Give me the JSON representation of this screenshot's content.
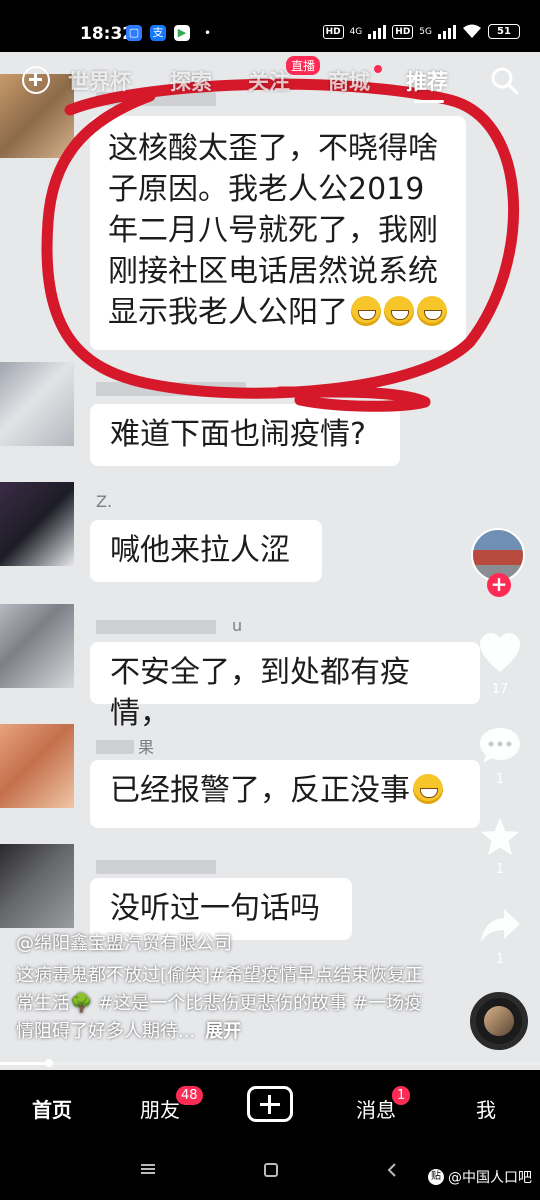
{
  "status_bar": {
    "time": "18:32",
    "app_icons": [
      "message-app-icon",
      "alipay-icon",
      "play-store-icon"
    ],
    "network_left": "4G",
    "network_right": "5G",
    "hd_label": "HD",
    "battery": "51"
  },
  "top_tabs": {
    "items": [
      "世界杯",
      "探索",
      "关注",
      "商城",
      "推荐"
    ],
    "active": "推荐",
    "live_badge": "直播"
  },
  "chat": {
    "messages": [
      {
        "text": "这核酸太歪了，不晓得啥子原因。我老人公2019年二月八号就死了，我刚刚接社区电话居然说系统显示我老人公阳了",
        "emoji_count": 3
      },
      {
        "text": "难道下面也闹疫情?"
      },
      {
        "name": "Z.",
        "text": "喊他来拉人涩"
      },
      {
        "name": "u",
        "text": "不安全了，到处都有疫情，"
      },
      {
        "name": "果",
        "text": "已经报警了，反正没事",
        "emoji_count": 1
      },
      {
        "text": "没听过一句话吗"
      }
    ]
  },
  "rail": {
    "like_count": "17",
    "comment_count": "1",
    "favorite_count": "1",
    "share_count": "1",
    "follow_symbol": "+"
  },
  "caption": {
    "author": "@绵阳鑫宝盟汽贸有限公司",
    "text": "这病毒鬼都不放过[偷笑]#希望疫情早点结束恢复正常生活🌳 #这是一个比悲伤更悲伤的故事 #一场疫情阻碍了好多人期待...",
    "expand": "展开"
  },
  "progress": 0.09,
  "bottom_nav": {
    "home": "首页",
    "friends": "朋友",
    "friends_badge": "48",
    "messages": "消息",
    "messages_badge": "1",
    "me": "我"
  },
  "watermark": "@中国人口吧",
  "watermark_logo": "贴",
  "colors": {
    "accent": "#fe2c55",
    "annotation_red": "#d5192a"
  }
}
